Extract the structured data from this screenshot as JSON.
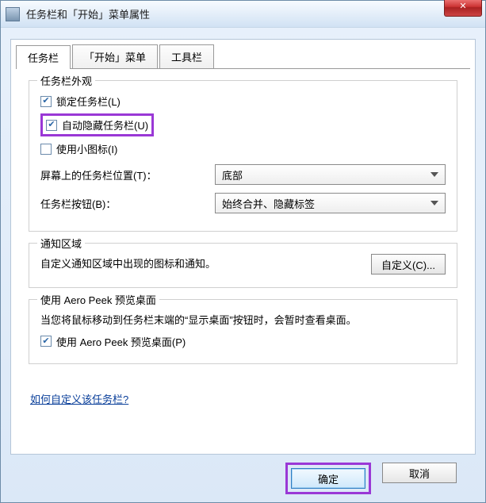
{
  "title": "任务栏和「开始」菜单属性",
  "tabs": {
    "taskbar": "任务栏",
    "start": "「开始」菜单",
    "toolbar": "工具栏"
  },
  "appearance": {
    "legend": "任务栏外观",
    "lock": "锁定任务栏(L)",
    "autohide": "自动隐藏任务栏(U)",
    "smallicons": "使用小图标(I)",
    "position_label": "屏幕上的任务栏位置(T)：",
    "position_value": "底部",
    "buttons_label": "任务栏按钮(B)：",
    "buttons_value": "始终合并、隐藏标签"
  },
  "notify": {
    "legend": "通知区域",
    "desc": "自定义通知区域中出现的图标和通知。",
    "customize": "自定义(C)..."
  },
  "aero": {
    "legend": "使用 Aero Peek 预览桌面",
    "desc": "当您将鼠标移动到任务栏末端的“显示桌面”按钮时，会暂时查看桌面。",
    "check": "使用 Aero Peek 预览桌面(P)"
  },
  "link": "如何自定义该任务栏?",
  "buttons": {
    "ok": "确定",
    "cancel": "取消"
  }
}
